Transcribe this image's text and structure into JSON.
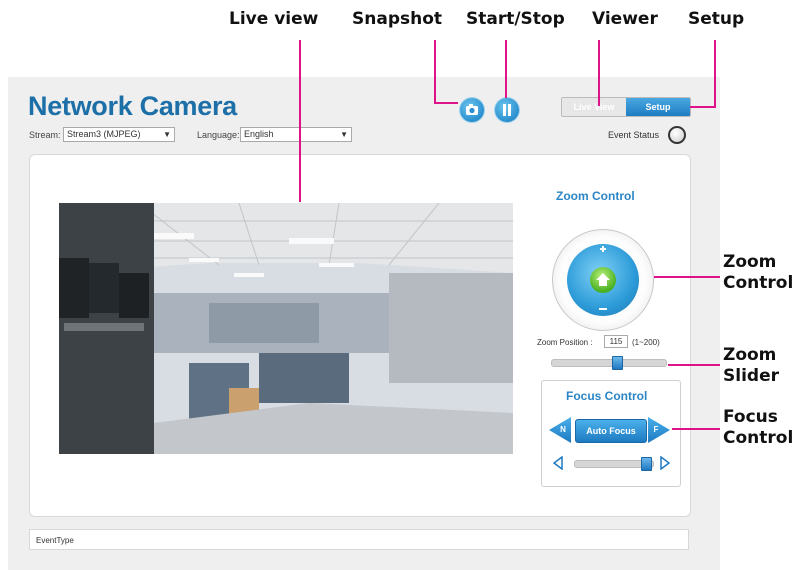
{
  "annotations": {
    "live_view": "Live view",
    "snapshot": "Snapshot",
    "start_stop": "Start/Stop",
    "viewer": "Viewer",
    "setup": "Setup",
    "zoom_control_line1": "Zoom",
    "zoom_control_line2": "Control",
    "zoom_slider_line1": "Zoom",
    "zoom_slider_line2": "Slider",
    "focus_control_line1": "Focus",
    "focus_control_line2": "Control"
  },
  "colors": {
    "callout_line": "#e0128a",
    "title": "#1d6fa8",
    "accent": "#2b86c5"
  },
  "header": {
    "title": "Network Camera",
    "tabs": {
      "live": "Live View",
      "setup": "Setup"
    },
    "stream_label": "Stream:",
    "stream_value": "Stream3 (MJPEG)",
    "language_label": "Language:",
    "language_value": "English",
    "event_status": "Event Status",
    "snapshot_icon": "camera-icon",
    "startstop_icon": "pause-icon"
  },
  "zoom": {
    "title": "Zoom Control",
    "position_label": "Zoom Position :",
    "position_value": "115",
    "range": "(1~200)",
    "slider_fraction": 0.57
  },
  "focus": {
    "title": "Focus Control",
    "near": "N",
    "far": "F",
    "auto": "Auto Focus",
    "slider_fraction": 0.95
  },
  "event_type": "EventType"
}
